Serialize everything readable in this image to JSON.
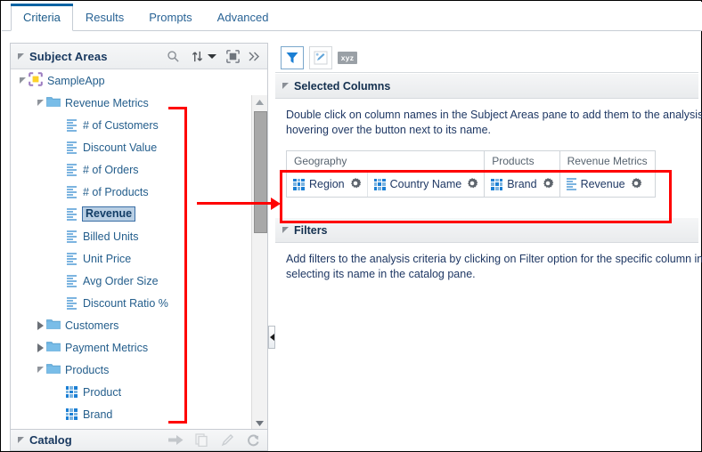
{
  "tabs": [
    {
      "label": "Criteria",
      "active": true
    },
    {
      "label": "Results",
      "active": false
    },
    {
      "label": "Prompts",
      "active": false
    },
    {
      "label": "Advanced",
      "active": false
    }
  ],
  "left_pane": {
    "title": "Subject Areas",
    "tools": [
      "search-icon",
      "sort-icon",
      "chevron-down-icon",
      "refresh-view-icon",
      "more-icon"
    ],
    "tree": [
      {
        "label": "SampleApp",
        "level": 0,
        "icon": "subject-area-icon",
        "twist": "open"
      },
      {
        "label": "Revenue Metrics",
        "level": 1,
        "icon": "folder-icon",
        "twist": "open"
      },
      {
        "label": "# of Customers",
        "level": 2,
        "icon": "measure-icon",
        "twist": "none"
      },
      {
        "label": "Discount Value",
        "level": 2,
        "icon": "measure-icon",
        "twist": "none"
      },
      {
        "label": "# of Orders",
        "level": 2,
        "icon": "measure-icon",
        "twist": "none"
      },
      {
        "label": "# of Products",
        "level": 2,
        "icon": "measure-icon",
        "twist": "none"
      },
      {
        "label": "Revenue",
        "level": 2,
        "icon": "measure-icon",
        "twist": "none",
        "selected": true
      },
      {
        "label": "Billed Units",
        "level": 2,
        "icon": "measure-icon",
        "twist": "none"
      },
      {
        "label": "Unit Price",
        "level": 2,
        "icon": "measure-icon",
        "twist": "none"
      },
      {
        "label": "Avg Order Size",
        "level": 2,
        "icon": "measure-icon",
        "twist": "none"
      },
      {
        "label": "Discount Ratio %",
        "level": 2,
        "icon": "measure-icon",
        "twist": "none"
      },
      {
        "label": "Customers",
        "level": 1,
        "icon": "folder-icon",
        "twist": "closed"
      },
      {
        "label": "Payment Metrics",
        "level": 1,
        "icon": "folder-icon",
        "twist": "closed"
      },
      {
        "label": "Products",
        "level": 1,
        "icon": "folder-icon",
        "twist": "open"
      },
      {
        "label": "Product",
        "level": 2,
        "icon": "attribute-icon",
        "twist": "none"
      },
      {
        "label": "Brand",
        "level": 2,
        "icon": "attribute-icon",
        "twist": "none"
      }
    ]
  },
  "catalog": {
    "title": "Catalog",
    "tools": [
      "arrow-right-icon",
      "copy-icon",
      "edit-icon",
      "refresh-icon"
    ]
  },
  "right_pane": {
    "toolbar": [
      "filter-icon",
      "edit-formula-icon",
      "xyz-icon"
    ],
    "selected_columns": {
      "title": "Selected Columns",
      "help_text_line1": "Double click on column names in the Subject Areas pane to add them to the analysis. (",
      "help_text_line2": "hovering over the button next to its name.",
      "groups": [
        {
          "name": "Geography",
          "items": [
            {
              "label": "Region",
              "icon": "attribute-icon",
              "gear": "gear-icon"
            },
            {
              "label": "Country Name",
              "icon": "attribute-icon",
              "gear": "gear-icon"
            }
          ]
        },
        {
          "name": "Products",
          "items": [
            {
              "label": "Brand",
              "icon": "attribute-icon",
              "gear": "gear-icon"
            }
          ]
        },
        {
          "name": "Revenue Metrics",
          "items": [
            {
              "label": "Revenue",
              "icon": "measure-icon",
              "gear": "gear-icon"
            }
          ]
        }
      ]
    },
    "filters": {
      "title": "Filters",
      "help_text_line1": "Add filters to the analysis criteria by clicking on Filter option for the specific column in th",
      "help_text_line2": "selecting its name in the catalog pane."
    }
  },
  "annotation": {
    "color": "#ff0000"
  }
}
